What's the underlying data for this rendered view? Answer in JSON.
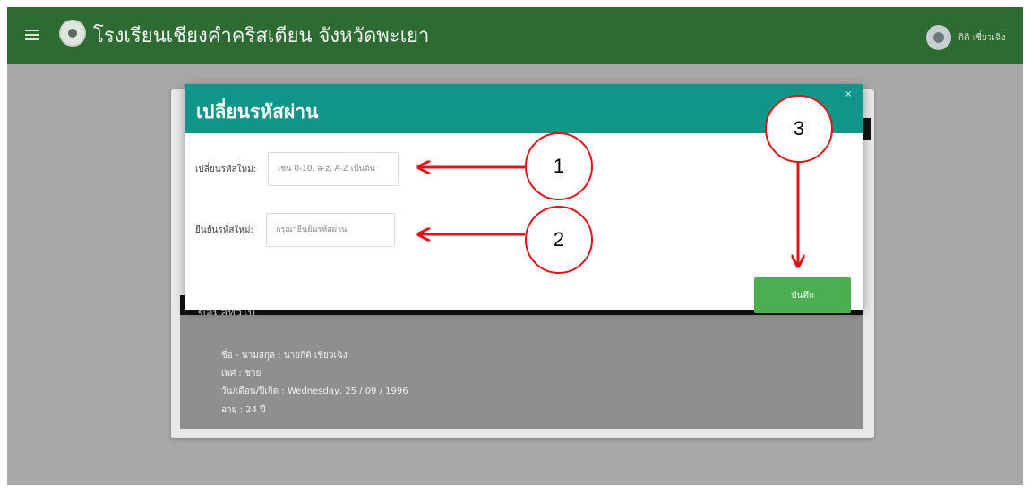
{
  "app": {
    "title": "โรงเรียนเชียงคำคริสเตียน จังหวัดพะเยา",
    "user_name": "กิติ เชี่ยวเฉิง",
    "header_color": "#2e6b33"
  },
  "icons": {
    "menu": "hamburger-icon",
    "logo": "school-logo-icon",
    "avatar": "user-avatar-icon",
    "close": "close-icon"
  },
  "modal": {
    "title": "เปลี่ยนรหัสผ่าน",
    "close_label": "×",
    "accent_color": "#0f9688",
    "new_password": {
      "label": "เปลี่ยนรหัสใหม่:",
      "placeholder": "เช่น 0-10, a-z, A-Z เป็นต้น",
      "value": ""
    },
    "confirm_password": {
      "label": "ยืนยันรหัสใหม่:",
      "placeholder": "กรุณายืนยันรหัสผ่าน",
      "value": ""
    },
    "save_label": "บันทึก",
    "save_color": "#4cae50"
  },
  "profile": {
    "section_title": "ข้อมูลทั่วไป",
    "lines": [
      "ชื่อ - นามสกุล : นายกิติ เชี่ยวเฉิง",
      "เพศ : ชาย",
      "วัน/เดือน/ปีเกิด : Wednesday, 25 / 09 / 1996",
      "อายุ : 24 ปี"
    ]
  },
  "annotations": {
    "markers": [
      "1",
      "2",
      "3"
    ],
    "color": "#e0141b"
  }
}
